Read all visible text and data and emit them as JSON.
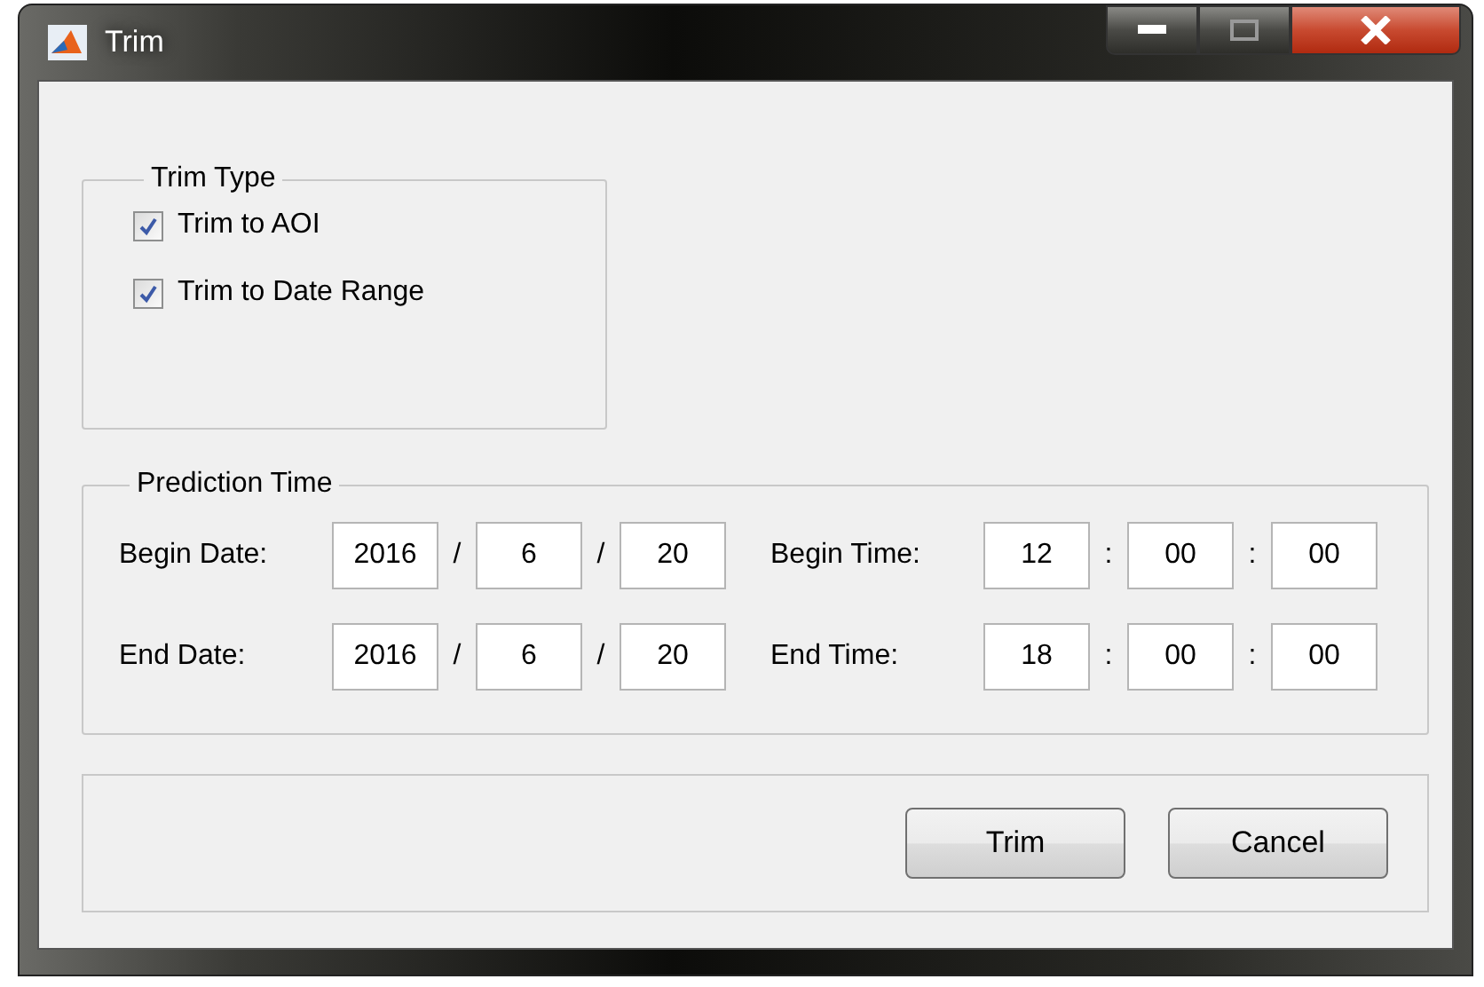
{
  "window": {
    "title": "Trim"
  },
  "trim_type": {
    "title": "Trim Type",
    "options": [
      {
        "label": "Trim to AOI",
        "checked": true
      },
      {
        "label": "Trim to Date Range",
        "checked": true
      }
    ]
  },
  "prediction_time": {
    "title": "Prediction Time",
    "rows": [
      {
        "date_label": "Begin Date:",
        "date": [
          {
            "value": "2016"
          },
          {
            "sep": "/",
            "value": "6"
          },
          {
            "sep": "/",
            "value": "20"
          }
        ],
        "time_label": "Begin Time:",
        "time": [
          {
            "value": "12"
          },
          {
            "sep": ":",
            "value": "00"
          },
          {
            "sep": ":",
            "value": "00"
          }
        ]
      },
      {
        "date_label": "End Date:",
        "date": [
          {
            "value": "2016"
          },
          {
            "sep": "/",
            "value": "6"
          },
          {
            "sep": "/",
            "value": "20"
          }
        ],
        "time_label": "End Time:",
        "time": [
          {
            "value": "18"
          },
          {
            "sep": ":",
            "value": "00"
          },
          {
            "sep": ":",
            "value": "00"
          }
        ]
      }
    ]
  },
  "buttons": [
    "Trim",
    "Cancel"
  ]
}
